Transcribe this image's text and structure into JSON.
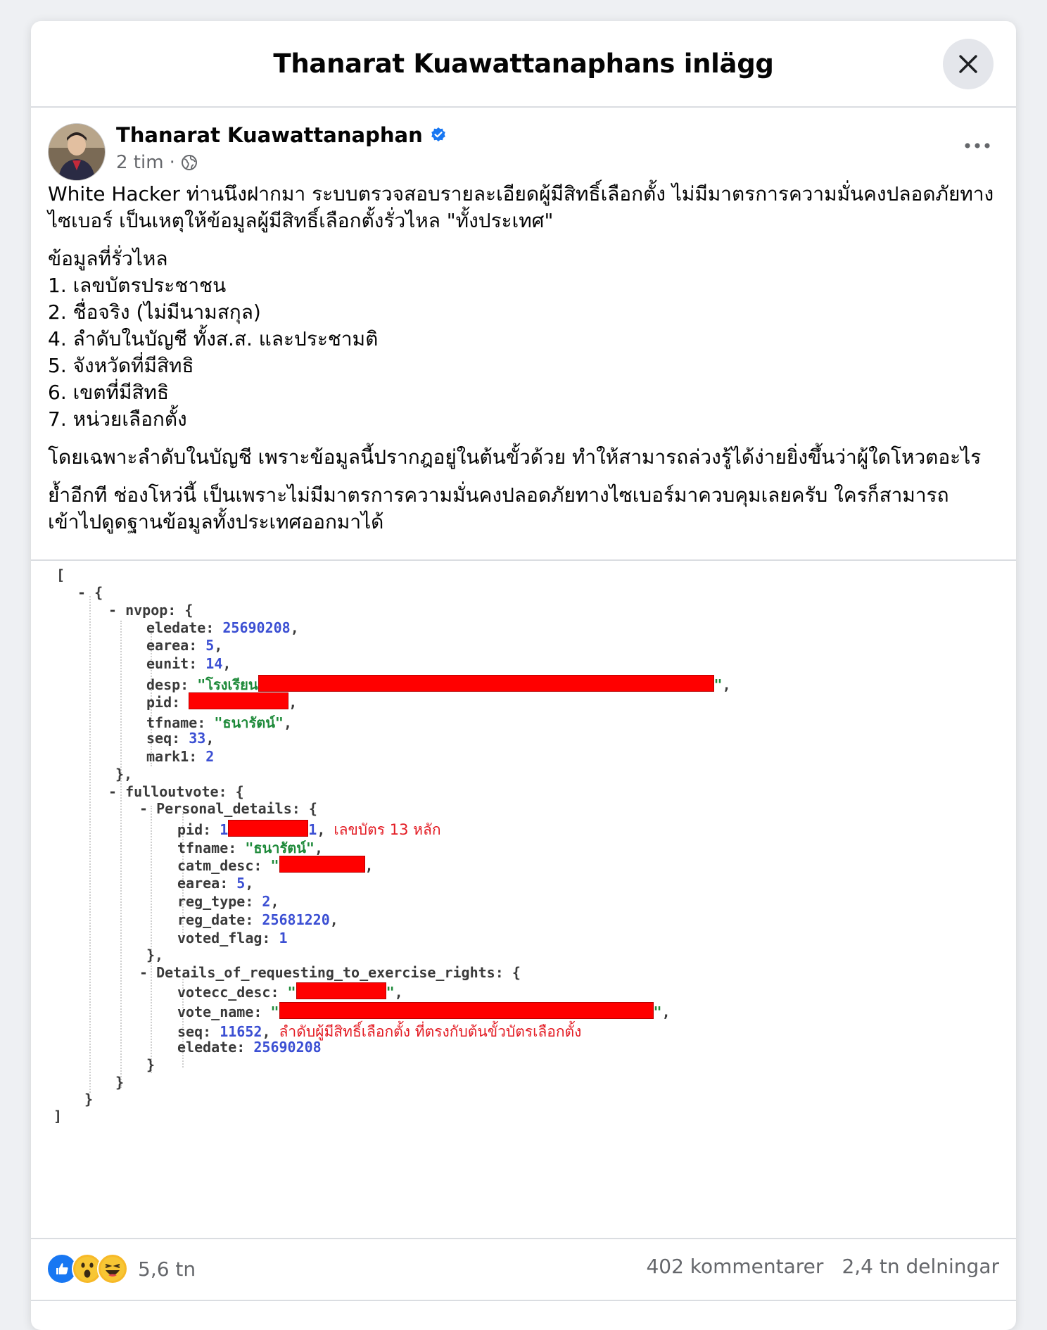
{
  "dialog": {
    "title": "Thanarat Kuawattanaphans inlägg"
  },
  "post": {
    "author": "Thanarat Kuawattanaphan",
    "time": "2 tim",
    "separator": "·",
    "intro": "White Hacker ท่านนึงฝากมา ระบบตรวจสอบรายละเอียดผู้มีสิทธิ์เลือกตั้ง ไม่มีมาตรการความมั่นคงปลอดภัยทางไซเบอร์ เป็นเหตุให้ข้อมูลผู้มีสิทธิ์เลือกตั้งรั่วไหล \"ทั้งประเทศ\"",
    "list_title": "ข้อมูลที่รั่วไหล",
    "list_items": [
      "1. เลขบัตรประชาชน",
      "2. ชื่อจริง (ไม่มีนามสกุล)",
      "4. ลำดับในบัญชี ทั้งส.ส. และประชามติ",
      "5. จังหวัดที่มีสิทธิ",
      "6. เขตที่มีสิทธิ",
      "7. หน่วยเลือกตั้ง"
    ],
    "para1": "โดยเฉพาะลำดับในบัญชี เพราะข้อมูลนี้ปรากฎอยู่ในต้นขั้วด้วย ทำให้สามารถล่วงรู้ได้ง่ายยิ่งขึ้นว่าผู้ใดโหวตอะไร",
    "para2": "ย้ำอีกที ช่องโหว่นี้ เป็นเพราะไม่มีมาตรการความมั่นคงปลอดภัยทางไซเบอร์มาควบคุมเลยครับ ใครก็สามารถเข้าไปดูดฐานข้อมูลทั้งประเทศออกมาได้"
  },
  "code": {
    "open_bracket": "[",
    "close_bracket": "]",
    "obj_open": "- {",
    "obj_close": "}",
    "nvpop_key": "- nvpop:",
    "brace": "{",
    "eledate_key": "eledate:",
    "eledate_val": "25690208",
    "earea_key": "earea:",
    "earea_val": "5",
    "eunit_key": "eunit:",
    "eunit_val": "14",
    "desp_key": "desp:",
    "desp_val": "\"โรงเรียน",
    "pid_key": "pid:",
    "tfname_key": "tfname:",
    "tfname_val": "\"ธนารัตน์\"",
    "seq_key": "seq:",
    "seq_val": "33",
    "mark1_key": "mark1:",
    "mark1_val": "2",
    "close_comma": "},",
    "fulloutvote_key": "- fulloutvote:",
    "personal_key": "- Personal_details:",
    "pid2_prefix": "1",
    "pid2_suffix": "1",
    "pid2_note": "เลขบัตร 13 หลัก",
    "tfname2_val": "\"ธนารัตน์\"",
    "catm_key": "catm_desc:",
    "quote": "\"",
    "earea2_val": "5",
    "reg_type_key": "reg_type:",
    "reg_type_val": "2",
    "reg_date_key": "reg_date:",
    "reg_date_val": "25681220",
    "voted_flag_key": "voted_flag:",
    "voted_flag_val": "1",
    "details_key": "- Details_of_requesting_to_exercise_rights:",
    "votecc_key": "votecc_desc:",
    "vote_name_key": "vote_name:",
    "seq2_val": "11652",
    "seq2_note": "ลำดับผู้มีสิทธิ์เลือกตั้ง ที่ตรงกับต้นขั้วบัตรเลือกตั้ง",
    "eledate2_val": "25690208"
  },
  "footer": {
    "reaction_count": "5,6 tn",
    "comments": "402 kommentarer",
    "shares": "2,4 tn delningar"
  }
}
